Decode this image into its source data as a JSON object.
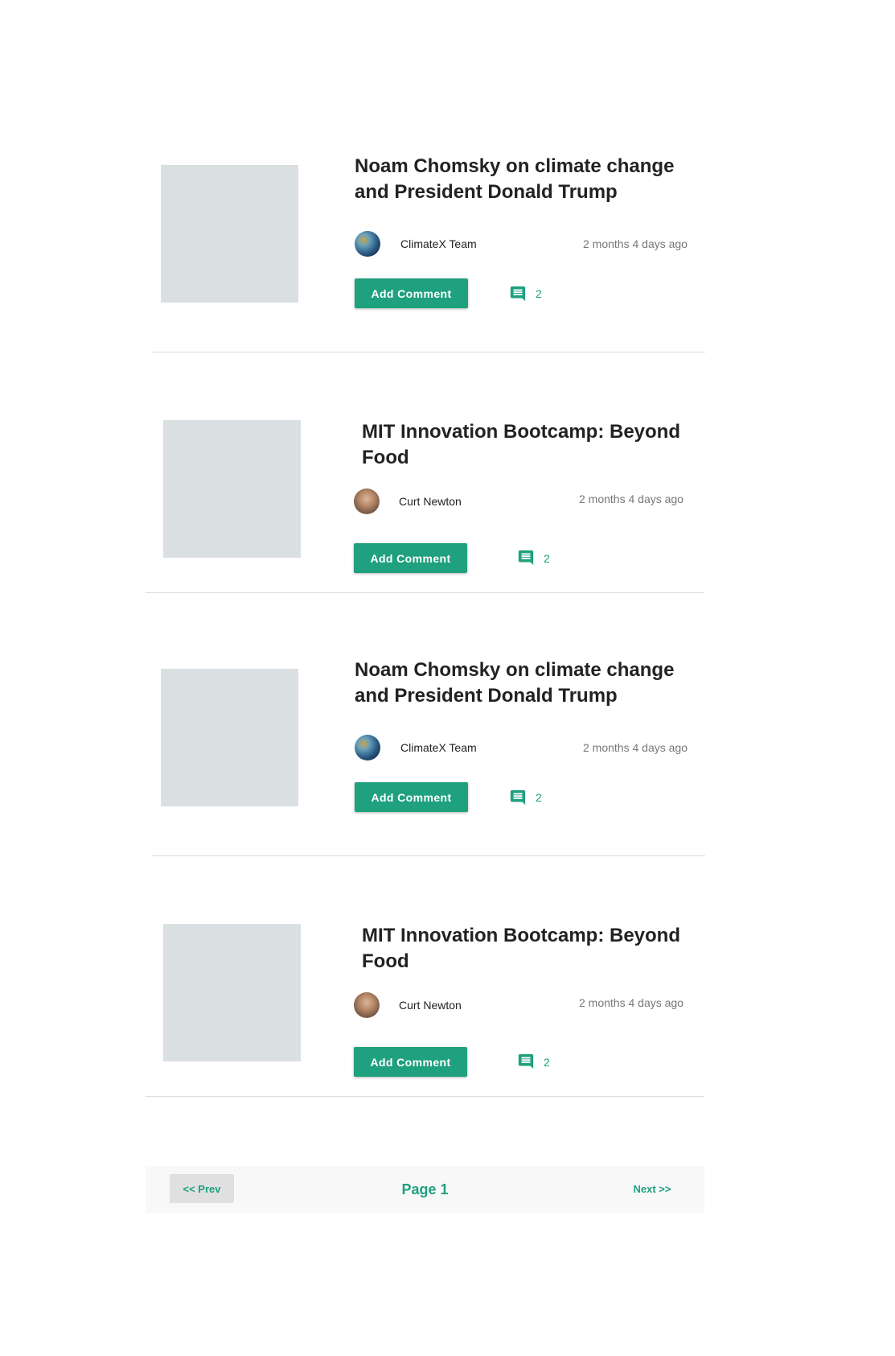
{
  "posts": [
    {
      "title": "Noam Chomsky on climate change and President Donald Trump",
      "author": "ClimateX Team",
      "avatar_icon": "earth-avatar",
      "time": "2 months 4 days ago",
      "add_comment_label": "Add Comment",
      "comment_count": "2"
    },
    {
      "title": "MIT Innovation Bootcamp: Beyond Food",
      "author": "Curt Newton",
      "avatar_icon": "person-avatar",
      "time": "2 months 4 days ago",
      "add_comment_label": "Add Comment",
      "comment_count": "2"
    },
    {
      "title": "Noam Chomsky on climate change and President Donald Trump",
      "author": "ClimateX Team",
      "avatar_icon": "earth-avatar",
      "time": "2 months 4 days ago",
      "add_comment_label": "Add Comment",
      "comment_count": "2"
    },
    {
      "title": "MIT Innovation Bootcamp: Beyond Food",
      "author": "Curt Newton",
      "avatar_icon": "person-avatar",
      "time": "2 months 4 days ago",
      "add_comment_label": "Add Comment",
      "comment_count": "2"
    }
  ],
  "pagination": {
    "prev_label": "<< Prev",
    "page_label": "Page 1",
    "next_label": "Next >>"
  },
  "colors": {
    "accent": "#1fa07e",
    "thumbnail_placeholder": "#dadfe2",
    "divider": "#dddddd",
    "meta_text": "#777777"
  }
}
